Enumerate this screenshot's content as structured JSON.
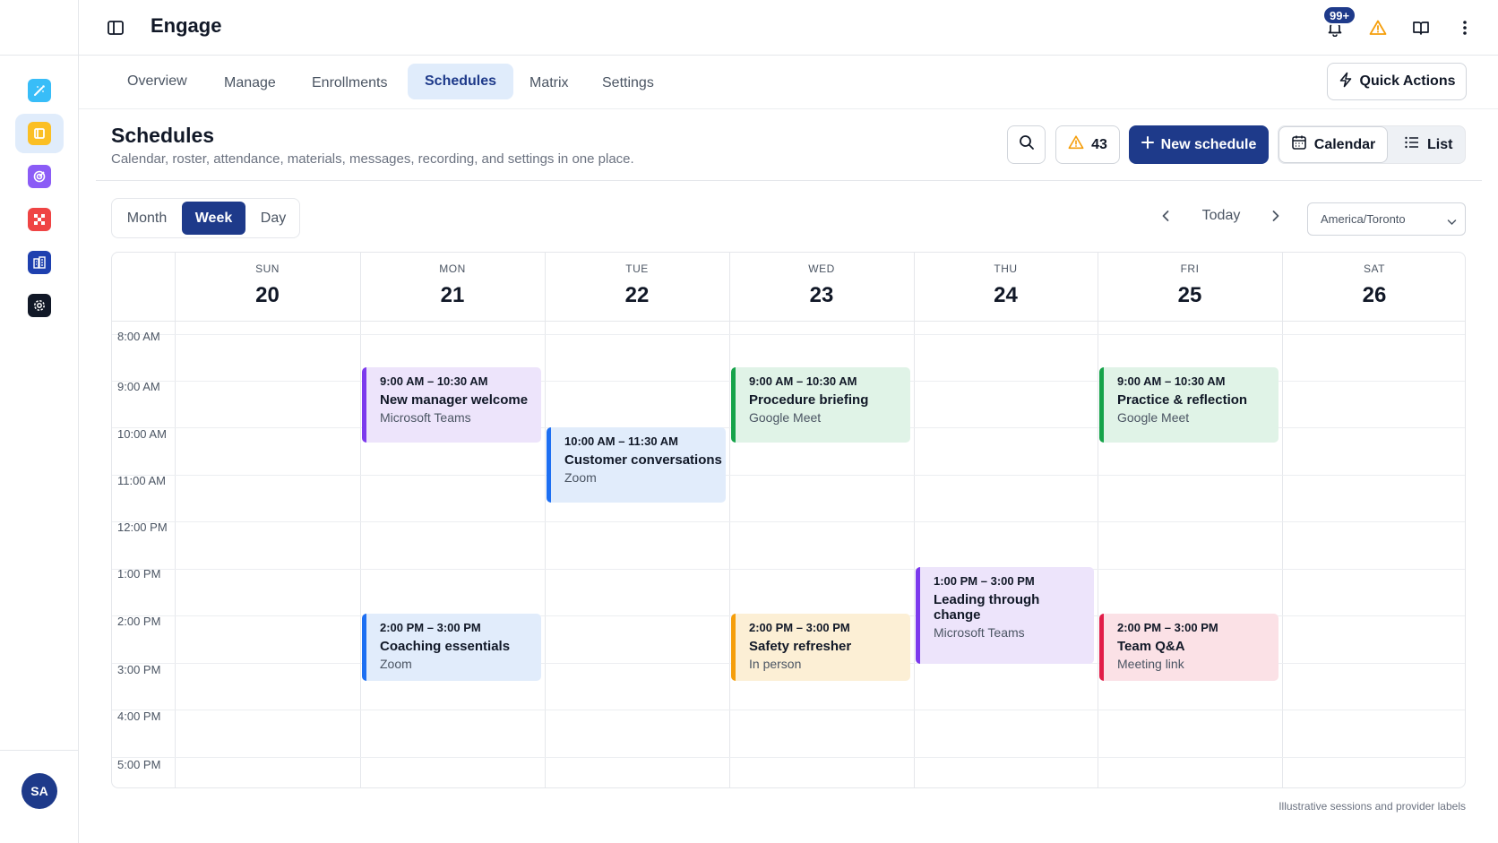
{
  "header": {
    "app_title": "Engage",
    "notification_count": "99+"
  },
  "sidebar": {
    "items": [
      {
        "icon": "wand-icon",
        "color": "#38bdf8"
      },
      {
        "icon": "book-icon",
        "color": "#fbbf24"
      },
      {
        "icon": "target-icon",
        "color": "#8b5cf6"
      },
      {
        "icon": "grid-icon",
        "color": "#ef4444"
      },
      {
        "icon": "building-icon",
        "color": "#1e40af"
      },
      {
        "icon": "settings-icon",
        "color": "#111827"
      }
    ],
    "avatar_initials": "SA"
  },
  "tabs": [
    {
      "label": "Overview"
    },
    {
      "label": "Manage"
    },
    {
      "label": "Enrollments"
    },
    {
      "label": "Schedules"
    },
    {
      "label": "Matrix"
    },
    {
      "label": "Settings"
    }
  ],
  "active_tab": "Schedules",
  "quick_actions_label": "Quick Actions",
  "page": {
    "title": "Schedules",
    "subtitle": "Calendar, roster, attendance, materials, messages, recording, and settings in one place.",
    "warning_count": "43",
    "new_schedule_label": "New schedule",
    "calendar_label": "Calendar",
    "list_label": "List"
  },
  "calendar": {
    "ranges": [
      "Month",
      "Week",
      "Day"
    ],
    "active_range": "Week",
    "today_label": "Today",
    "timezone": "America/Toronto",
    "days": [
      {
        "name": "SUN",
        "date": "20"
      },
      {
        "name": "MON",
        "date": "21"
      },
      {
        "name": "TUE",
        "date": "22"
      },
      {
        "name": "WED",
        "date": "23"
      },
      {
        "name": "THU",
        "date": "24"
      },
      {
        "name": "FRI",
        "date": "25"
      },
      {
        "name": "SAT",
        "date": "26"
      }
    ],
    "times": [
      "8:00 AM",
      "9:00 AM",
      "10:00 AM",
      "11:00 AM",
      "12:00 PM",
      "1:00 PM",
      "2:00 PM",
      "3:00 PM",
      "4:00 PM",
      "5:00 PM"
    ],
    "events": [
      {
        "day": "MON",
        "time": "9:00 AM – 10:30 AM",
        "title": "New manager welcome",
        "place": "Microsoft Teams",
        "color": "purple"
      },
      {
        "day": "TUE",
        "time": "10:00 AM – 11:30 AM",
        "title": "Customer conversations",
        "place": "Zoom",
        "color": "blue"
      },
      {
        "day": "WED",
        "time": "9:00 AM – 10:30 AM",
        "title": "Procedure briefing",
        "place": "Google Meet",
        "color": "green"
      },
      {
        "day": "FRI",
        "time": "9:00 AM – 10:30 AM",
        "title": "Practice & reflection",
        "place": "Google Meet",
        "color": "green"
      },
      {
        "day": "THU",
        "time": "1:00 PM – 3:00 PM",
        "title": "Leading through change",
        "place": "Microsoft Teams",
        "color": "purple"
      },
      {
        "day": "MON",
        "time": "2:00 PM – 3:00 PM",
        "title": "Coaching essentials",
        "place": "Zoom",
        "color": "blue"
      },
      {
        "day": "WED",
        "time": "2:00 PM – 3:00 PM",
        "title": "Safety refresher",
        "place": "In person",
        "color": "yellow"
      },
      {
        "day": "FRI",
        "time": "2:00 PM – 3:00 PM",
        "title": "Team Q&A",
        "place": "Meeting link",
        "color": "red"
      }
    ]
  },
  "footnote": "Illustrative sessions and provider labels",
  "colors": {
    "primary": "#1e3a8a",
    "active_tab_bg": "#e0ecfb",
    "warning": "#f59e0b"
  }
}
